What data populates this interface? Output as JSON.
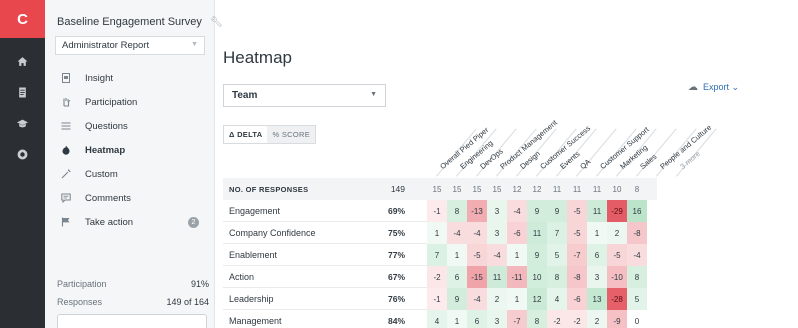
{
  "rail": {
    "logo": "C",
    "icons": [
      "home-icon",
      "document-icon",
      "graduation-cap-icon",
      "gear-icon"
    ]
  },
  "sidebar": {
    "survey_title": "Baseline Engagement Survey",
    "report_select": "Administrator Report",
    "items": [
      {
        "label": "Insight",
        "icon": "insight-icon"
      },
      {
        "label": "Participation",
        "icon": "hand-icon"
      },
      {
        "label": "Questions",
        "icon": "list-icon"
      },
      {
        "label": "Heatmap",
        "icon": "heatmap-icon",
        "active": true
      },
      {
        "label": "Custom",
        "icon": "wand-icon"
      },
      {
        "label": "Comments",
        "icon": "comment-icon"
      },
      {
        "label": "Take action",
        "icon": "flag-icon",
        "badge": "2"
      }
    ],
    "stats": [
      {
        "label": "Participation",
        "value": "91%"
      },
      {
        "label": "Responses",
        "value": "149 of 164"
      }
    ]
  },
  "main": {
    "title": "Heatmap",
    "team_select": "Team",
    "export_label": "Export ⌄",
    "toggle": {
      "delta": "Δ DELTA",
      "score": "% SCORE"
    }
  },
  "heatmap": {
    "columns": [
      "Overall Pied Piper",
      "Engineering",
      "DevOps",
      "Product Management",
      "Design",
      "Customer Success",
      "Events",
      "QA",
      "Customer Support",
      "Marketing",
      "Sales",
      "People and Culture",
      "3 more"
    ],
    "header_row": {
      "label": "NO. OF RESPONSES",
      "score": "149",
      "values": [
        "15",
        "15",
        "15",
        "15",
        "12",
        "12",
        "11",
        "11",
        "11",
        "10",
        "8"
      ]
    },
    "rows": [
      {
        "label": "Engagement",
        "score": "69%",
        "values": [
          -1,
          8,
          -13,
          3,
          -4,
          9,
          9,
          -5,
          11,
          -29,
          16
        ]
      },
      {
        "label": "Company Confidence",
        "score": "75%",
        "values": [
          1,
          -4,
          -4,
          3,
          -6,
          11,
          7,
          -5,
          1,
          2,
          -8
        ]
      },
      {
        "label": "Enablement",
        "score": "77%",
        "values": [
          7,
          1,
          -5,
          -4,
          1,
          9,
          5,
          -7,
          6,
          -5,
          -4
        ]
      },
      {
        "label": "Action",
        "score": "67%",
        "values": [
          -2,
          6,
          -15,
          11,
          -11,
          10,
          8,
          -8,
          3,
          -10,
          8
        ]
      },
      {
        "label": "Leadership",
        "score": "76%",
        "values": [
          -1,
          9,
          -4,
          2,
          1,
          12,
          4,
          -6,
          13,
          -28,
          5
        ]
      },
      {
        "label": "Management",
        "score": "84%",
        "values": [
          4,
          1,
          6,
          3,
          -7,
          8,
          -2,
          -2,
          2,
          -9,
          0
        ]
      }
    ]
  },
  "colors": {
    "brand": "#e8474d",
    "positive": "#3fb36a",
    "negative": "#e0444f",
    "link": "#2f6db5"
  }
}
